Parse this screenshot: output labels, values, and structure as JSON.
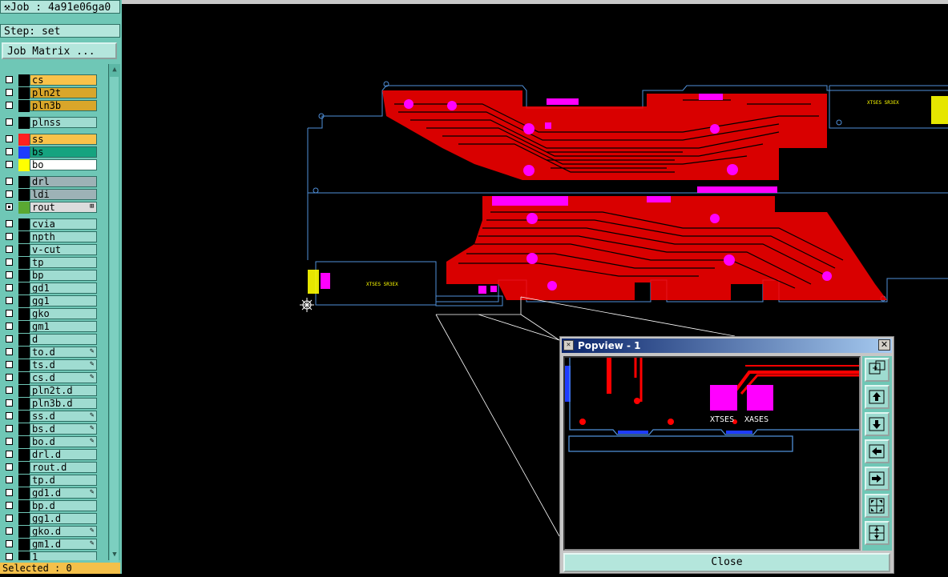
{
  "header": {
    "job_label": "Job : 4a91e06ga0",
    "step_label": "Step: set",
    "job_matrix_button": "Job Matrix ..."
  },
  "layers": [
    {
      "name": "cs",
      "color": "#f9c24a",
      "swatch": "#000000",
      "checked": false,
      "mark": ""
    },
    {
      "name": "pln2t",
      "color": "#d9a62a",
      "swatch": "#000000",
      "checked": false,
      "mark": ""
    },
    {
      "name": "pln3b",
      "color": "#d9a62a",
      "swatch": "#000000",
      "checked": false,
      "mark": ""
    },
    {
      "name": "plnss",
      "color": "#9fdcd1",
      "swatch": "#000000",
      "checked": false,
      "mark": ""
    },
    {
      "name": "ss",
      "color": "#f9c24a",
      "swatch": "#ff2020",
      "checked": false,
      "mark": ""
    },
    {
      "name": "bs",
      "color": "#15a37f",
      "swatch": "#1e3cff",
      "checked": false,
      "mark": ""
    },
    {
      "name": "bo",
      "color": "#ffffff",
      "swatch": "#ffff00",
      "checked": false,
      "mark": ""
    },
    {
      "name": "drl",
      "color": "#9db2b6",
      "swatch": "#000000",
      "checked": false,
      "mark": ""
    },
    {
      "name": "ldi",
      "color": "#9db2b6",
      "swatch": "#000000",
      "checked": false,
      "mark": ""
    },
    {
      "name": "rout",
      "color": "#dcdcdc",
      "swatch": "#5aa832",
      "checked": true,
      "mark": "⊞"
    },
    {
      "name": "cvia",
      "color": "#9fdcd1",
      "swatch": "#000000",
      "checked": false,
      "mark": ""
    },
    {
      "name": "npth",
      "color": "#9fdcd1",
      "swatch": "#000000",
      "checked": false,
      "mark": ""
    },
    {
      "name": "v-cut",
      "color": "#9fdcd1",
      "swatch": "#000000",
      "checked": false,
      "mark": ""
    },
    {
      "name": "tp",
      "color": "#9fdcd1",
      "swatch": "#000000",
      "checked": false,
      "mark": ""
    },
    {
      "name": "bp",
      "color": "#9fdcd1",
      "swatch": "#000000",
      "checked": false,
      "mark": ""
    },
    {
      "name": "gd1",
      "color": "#9fdcd1",
      "swatch": "#000000",
      "checked": false,
      "mark": ""
    },
    {
      "name": "gg1",
      "color": "#9fdcd1",
      "swatch": "#000000",
      "checked": false,
      "mark": ""
    },
    {
      "name": "gko",
      "color": "#9fdcd1",
      "swatch": "#000000",
      "checked": false,
      "mark": ""
    },
    {
      "name": "gm1",
      "color": "#9fdcd1",
      "swatch": "#000000",
      "checked": false,
      "mark": ""
    },
    {
      "name": "d",
      "color": "#9fdcd1",
      "swatch": "#000000",
      "checked": false,
      "mark": ""
    },
    {
      "name": "to.d",
      "color": "#9fdcd1",
      "swatch": "#000000",
      "checked": false,
      "mark": "✎"
    },
    {
      "name": "ts.d",
      "color": "#9fdcd1",
      "swatch": "#000000",
      "checked": false,
      "mark": "✎"
    },
    {
      "name": "cs.d",
      "color": "#9fdcd1",
      "swatch": "#000000",
      "checked": false,
      "mark": "✎"
    },
    {
      "name": "pln2t.d",
      "color": "#9fdcd1",
      "swatch": "#000000",
      "checked": false,
      "mark": ""
    },
    {
      "name": "pln3b.d",
      "color": "#9fdcd1",
      "swatch": "#000000",
      "checked": false,
      "mark": ""
    },
    {
      "name": "ss.d",
      "color": "#9fdcd1",
      "swatch": "#000000",
      "checked": false,
      "mark": "✎"
    },
    {
      "name": "bs.d",
      "color": "#9fdcd1",
      "swatch": "#000000",
      "checked": false,
      "mark": "✎"
    },
    {
      "name": "bo.d",
      "color": "#9fdcd1",
      "swatch": "#000000",
      "checked": false,
      "mark": "✎"
    },
    {
      "name": "drl.d",
      "color": "#9fdcd1",
      "swatch": "#000000",
      "checked": false,
      "mark": ""
    },
    {
      "name": "rout.d",
      "color": "#9fdcd1",
      "swatch": "#000000",
      "checked": false,
      "mark": ""
    },
    {
      "name": "tp.d",
      "color": "#9fdcd1",
      "swatch": "#000000",
      "checked": false,
      "mark": ""
    },
    {
      "name": "gd1.d",
      "color": "#9fdcd1",
      "swatch": "#000000",
      "checked": false,
      "mark": "✎"
    },
    {
      "name": "bp.d",
      "color": "#9fdcd1",
      "swatch": "#000000",
      "checked": false,
      "mark": ""
    },
    {
      "name": "gg1.d",
      "color": "#9fdcd1",
      "swatch": "#000000",
      "checked": false,
      "mark": ""
    },
    {
      "name": "gko.d",
      "color": "#9fdcd1",
      "swatch": "#000000",
      "checked": false,
      "mark": "✎"
    },
    {
      "name": "gm1.d",
      "color": "#9fdcd1",
      "swatch": "#000000",
      "checked": false,
      "mark": "✎"
    },
    {
      "name": "1",
      "color": "#9fdcd1",
      "swatch": "#000000",
      "checked": false,
      "mark": ""
    }
  ],
  "status": {
    "selected_label": "Selected : 0"
  },
  "popview": {
    "title": "Popview - 1",
    "close_label": "Close",
    "pad_labels": [
      "XTSES",
      "XASES"
    ],
    "tools": [
      "zoom-fit-icon",
      "pan-up-icon",
      "pan-down-icon",
      "pan-left-icon",
      "pan-right-icon",
      "zoom-out-icon",
      "zoom-in-icon"
    ]
  },
  "board": {
    "copper_color": "#ff0000",
    "outline_color": "#4f8fd8",
    "pad_color": "#ff00ff",
    "silk_color": "#ffff00",
    "label_top_right": "XTSES SR3EX",
    "label_left": "XTSES SR3EX"
  }
}
